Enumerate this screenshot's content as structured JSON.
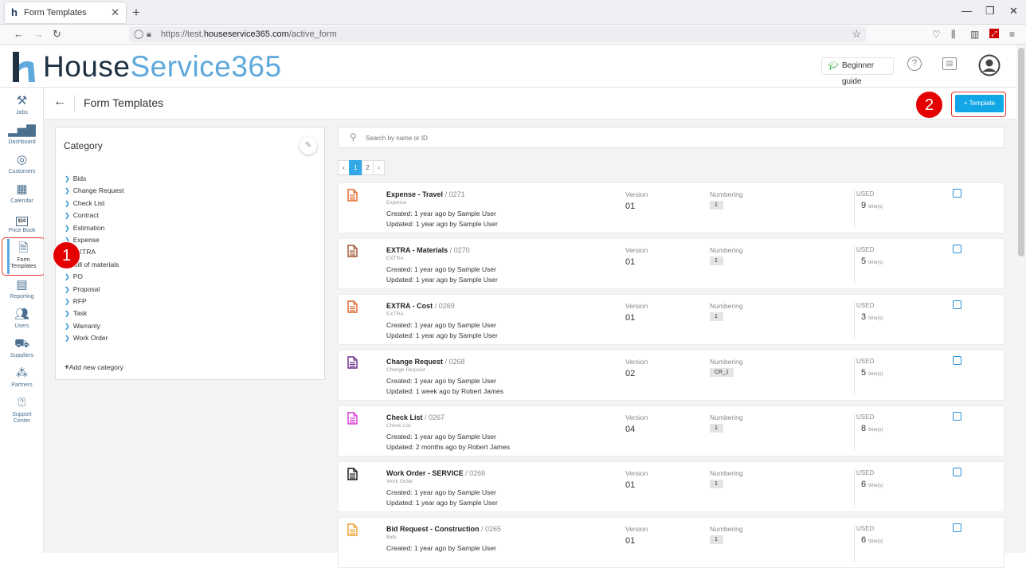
{
  "browser": {
    "tab_title": "Form Templates",
    "url_prefix": "https://test.",
    "url_host": "houseservice365.com",
    "url_path": "/active_form"
  },
  "header": {
    "logo_part1": "House",
    "logo_part2": "Service365",
    "beginner_guide": "Beginner guide"
  },
  "sidebar": {
    "items": [
      {
        "label": "Jobs",
        "icon": "tools-icon"
      },
      {
        "label": "Dashboard",
        "icon": "chart-icon"
      },
      {
        "label": "Customers",
        "icon": "target-icon"
      },
      {
        "label": "Calendar",
        "icon": "calendar-icon"
      },
      {
        "label": "Price Book",
        "icon": "price-book-icon"
      },
      {
        "label": "Form Templates",
        "icon": "form-templates-icon"
      },
      {
        "label": "Reporting",
        "icon": "reporting-icon"
      },
      {
        "label": "Users",
        "icon": "users-icon"
      },
      {
        "label": "Suppliers",
        "icon": "truck-icon"
      },
      {
        "label": "Partners",
        "icon": "partners-icon"
      },
      {
        "label": "Support Center",
        "icon": "support-icon"
      }
    ],
    "price_book_mark": "$10"
  },
  "annotations": {
    "badge1": "1",
    "badge2": "2"
  },
  "page": {
    "title": "Form Templates",
    "add_template": "+ Template",
    "search_placeholder": "Search by name or ID"
  },
  "category": {
    "heading": "Category",
    "items": [
      "Bids",
      "Change Request",
      "Check List",
      "Contract",
      "Estimation",
      "Expense",
      "EXTRA",
      "Bill of materials",
      "PO",
      "Proposal",
      "RFP",
      "Task",
      "Warranty",
      "Work Order"
    ],
    "add_new": "Add new category"
  },
  "pagination": {
    "prev": "‹",
    "pages": [
      "1",
      "2"
    ],
    "next": "›",
    "current": "1"
  },
  "labels": {
    "version": "Version",
    "numbering": "Numbering",
    "used": "USED",
    "times": "time(s)"
  },
  "templates": [
    {
      "name": "Expense - Travel",
      "id": "/ 0271",
      "category": "Expense",
      "created": "Created: 1 year ago by Sample User",
      "updated": "Updated: 1 year ago by Sample User",
      "version": "01",
      "numbering": "1",
      "used": "9",
      "icon_color": "#e2662a"
    },
    {
      "name": "EXTRA - Materials",
      "id": "/ 0270",
      "category": "EXTRA",
      "created": "Created: 1 year ago by Sample User",
      "updated": "Updated: 1 year ago by Sample User",
      "version": "01",
      "numbering": "1",
      "used": "5",
      "icon_color": "#a0522d"
    },
    {
      "name": "EXTRA - Cost",
      "id": "/ 0269",
      "category": "EXTRA",
      "created": "Created: 1 year ago by Sample User",
      "updated": "Updated: 1 year ago by Sample User",
      "version": "01",
      "numbering": "1",
      "used": "3",
      "icon_color": "#e2662a"
    },
    {
      "name": "Change Request",
      "id": "/ 0268",
      "category": "Change Request",
      "created": "Created: 1 year ago by Sample User",
      "updated": "Updated: 1 week ago by Robert James",
      "version": "02",
      "numbering": "CR_1",
      "used": "5",
      "icon_color": "#6a2c8a"
    },
    {
      "name": "Check List",
      "id": "/ 0267",
      "category": "Check List",
      "created": "Created: 1 year ago by Sample User",
      "updated": "Updated: 2 months ago by Robert James",
      "version": "04",
      "numbering": "1",
      "used": "8",
      "icon_color": "#d43ad4"
    },
    {
      "name": "Work Order - SERVICE",
      "id": "/ 0266",
      "category": "Work Order",
      "created": "Created: 1 year ago by Sample User",
      "updated": "Updated: 1 year ago by Sample User",
      "version": "01",
      "numbering": "1",
      "used": "6",
      "icon_color": "#111111"
    },
    {
      "name": "Bid Request - Construction",
      "id": "/ 0265",
      "category": "Bids",
      "created": "Created: 1 year ago by Sample User",
      "updated": "",
      "version": "01",
      "numbering": "1",
      "used": "6",
      "icon_color": "#f0a030"
    }
  ]
}
